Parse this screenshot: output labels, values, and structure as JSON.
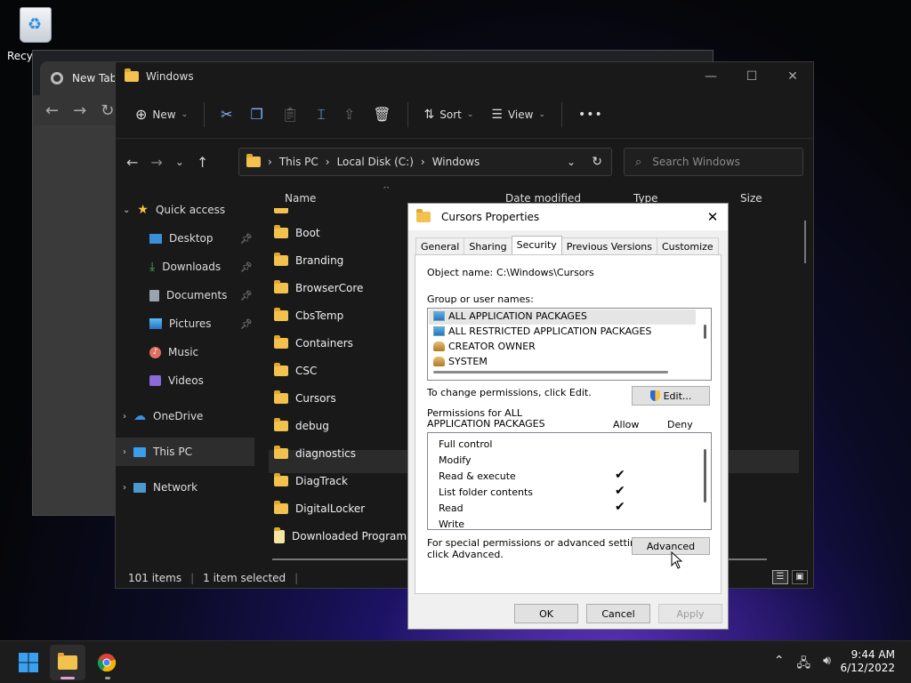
{
  "desktop": {
    "recycle_bin_label": "Recyc"
  },
  "chrome": {
    "tab_title": "New Tab"
  },
  "explorer": {
    "title": "Windows",
    "toolbar": {
      "new_label": "New",
      "sort_label": "Sort",
      "view_label": "View",
      "more_label": "•••"
    },
    "breadcrumb": [
      "This PC",
      "Local Disk (C:)",
      "Windows"
    ],
    "search_placeholder": "Search Windows",
    "nav": {
      "quick_access": "Quick access",
      "desktop": "Desktop",
      "downloads": "Downloads",
      "documents": "Documents",
      "pictures": "Pictures",
      "music": "Music",
      "videos": "Videos",
      "onedrive": "OneDrive",
      "this_pc": "This PC",
      "network": "Network"
    },
    "columns": {
      "name": "Name",
      "date_modified": "Date modified",
      "type": "Type",
      "size": "Size"
    },
    "files": [
      "Boot",
      "Branding",
      "BrowserCore",
      "CbsTemp",
      "Containers",
      "CSC",
      "Cursors",
      "debug",
      "diagnostics",
      "DiagTrack",
      "DigitalLocker",
      "Downloaded Program Fi"
    ],
    "status": {
      "items": "101 items",
      "selected": "1 item selected"
    }
  },
  "dialog": {
    "title": "Cursors Properties",
    "tabs": [
      "General",
      "Sharing",
      "Security",
      "Previous Versions",
      "Customize"
    ],
    "object_name_label": "Object name:",
    "object_name_value": "C:\\Windows\\Cursors",
    "group_label": "Group or user names:",
    "groups": [
      "ALL APPLICATION PACKAGES",
      "ALL RESTRICTED APPLICATION PACKAGES",
      "CREATOR OWNER",
      "SYSTEM"
    ],
    "change_text": "To change permissions, click Edit.",
    "edit_label": "Edit...",
    "perm_for_line1": "Permissions for ALL",
    "perm_for_line2": "APPLICATION PACKAGES",
    "allow_label": "Allow",
    "deny_label": "Deny",
    "permissions": [
      "Full control",
      "Modify",
      "Read & execute",
      "List folder contents",
      "Read",
      "Write"
    ],
    "special_line1": "For special permissions or advanced settings,",
    "special_line2": "click Advanced.",
    "advanced_label": "Advanced",
    "ok_label": "OK",
    "cancel_label": "Cancel",
    "apply_label": "Apply"
  },
  "taskbar": {
    "time": "9:44 AM",
    "date": "6/12/2022"
  }
}
